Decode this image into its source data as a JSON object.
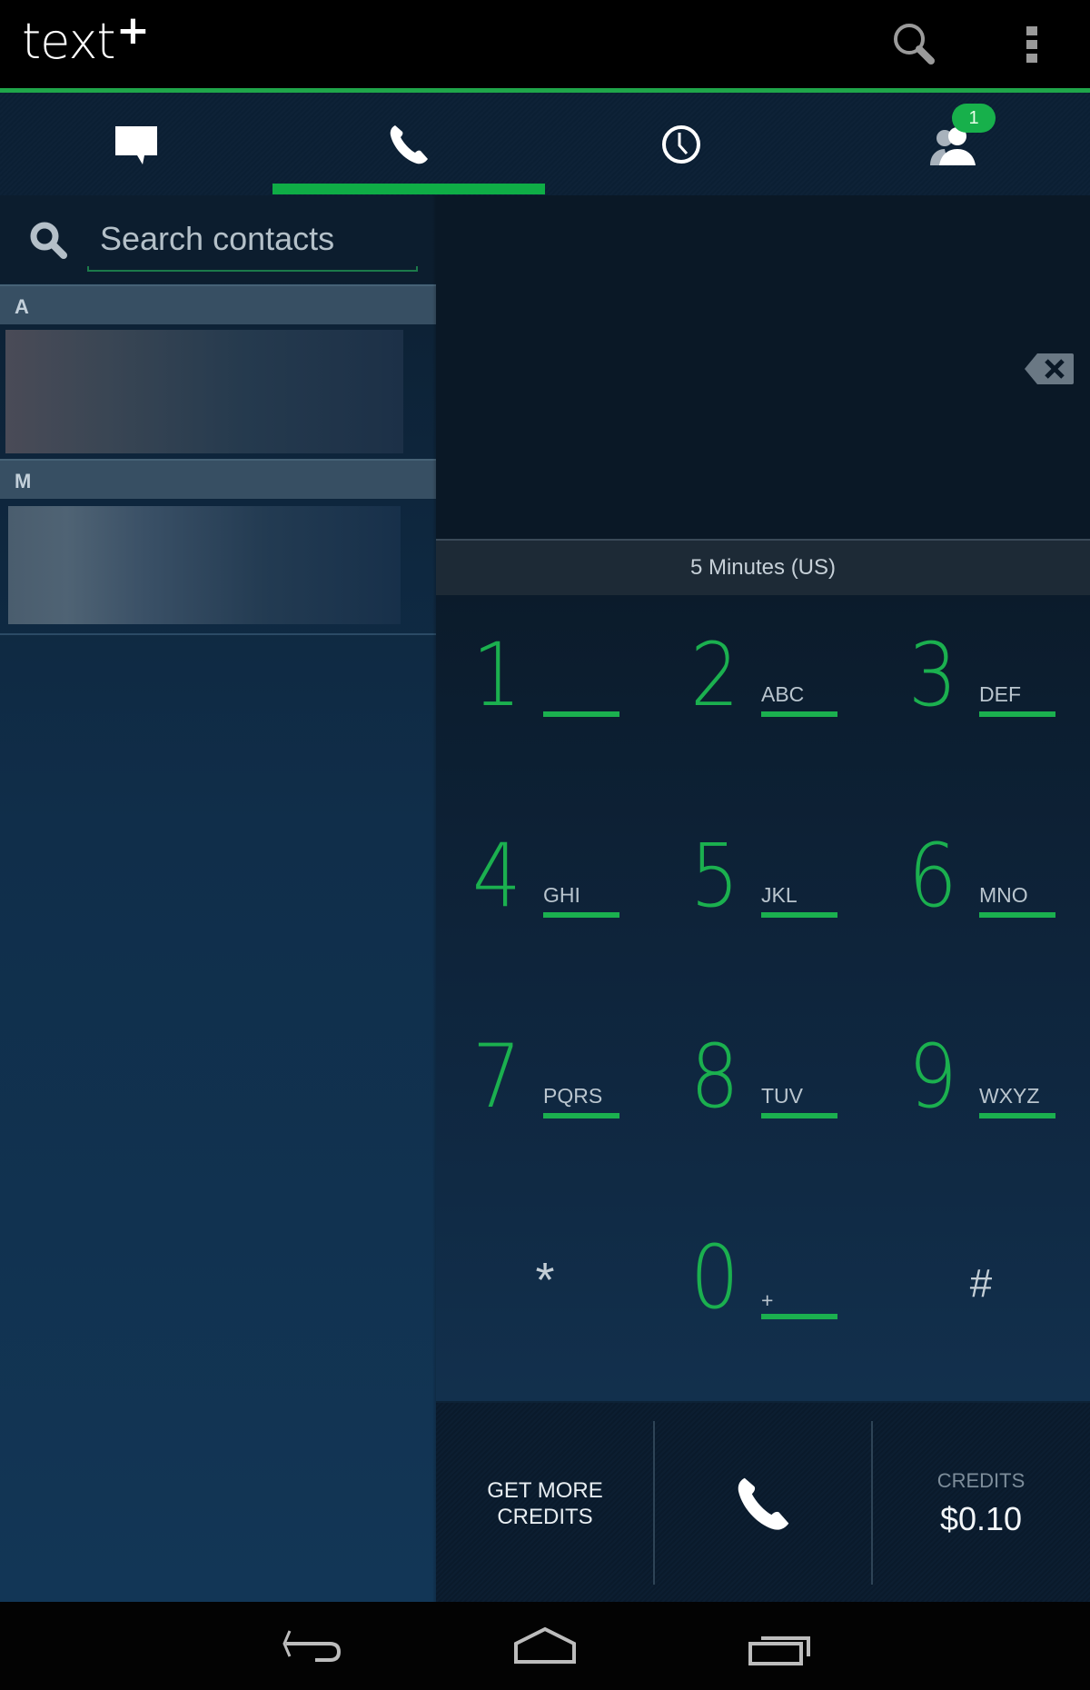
{
  "app": {
    "logo_text": "text",
    "logo_plus": "+"
  },
  "actionbar": {
    "icons": [
      "search-icon",
      "overflow-menu-icon"
    ]
  },
  "tabs": [
    {
      "id": "messages",
      "icon": "chat-bubble-icon",
      "selected": false
    },
    {
      "id": "calls",
      "icon": "phone-icon",
      "selected": true
    },
    {
      "id": "history",
      "icon": "clock-icon",
      "selected": false
    },
    {
      "id": "contacts",
      "icon": "contacts-icon",
      "selected": false,
      "badge": "1"
    }
  ],
  "colors": {
    "accent": "#1bb04f",
    "tab_indicator": "#0fad46",
    "badge": "#17b04b",
    "background_dark": "#0a1826"
  },
  "contacts_pane": {
    "search": {
      "placeholder": "Search contacts",
      "value": ""
    },
    "sections": [
      {
        "letter": "A",
        "contacts": [
          {
            "name_hidden": true
          }
        ]
      },
      {
        "letter": "M",
        "contacts": [
          {
            "name_hidden": true
          }
        ]
      }
    ]
  },
  "dialer": {
    "number": "",
    "rate_text": "5 Minutes (US)",
    "keys": [
      {
        "digit": "1",
        "letters": ""
      },
      {
        "digit": "2",
        "letters": "ABC"
      },
      {
        "digit": "3",
        "letters": "DEF"
      },
      {
        "digit": "4",
        "letters": "GHI"
      },
      {
        "digit": "5",
        "letters": "JKL"
      },
      {
        "digit": "6",
        "letters": "MNO"
      },
      {
        "digit": "7",
        "letters": "PQRS"
      },
      {
        "digit": "8",
        "letters": "TUV"
      },
      {
        "digit": "9",
        "letters": "WXYZ"
      },
      {
        "symbol": "*"
      },
      {
        "digit": "0",
        "letters": "+"
      },
      {
        "symbol": "#"
      }
    ],
    "bottom": {
      "get_more_credits": "GET MORE CREDITS",
      "credits_label": "CREDITS",
      "credits_value": "$0.10"
    }
  },
  "system_nav": [
    "back-icon",
    "home-icon",
    "recent-apps-icon"
  ]
}
